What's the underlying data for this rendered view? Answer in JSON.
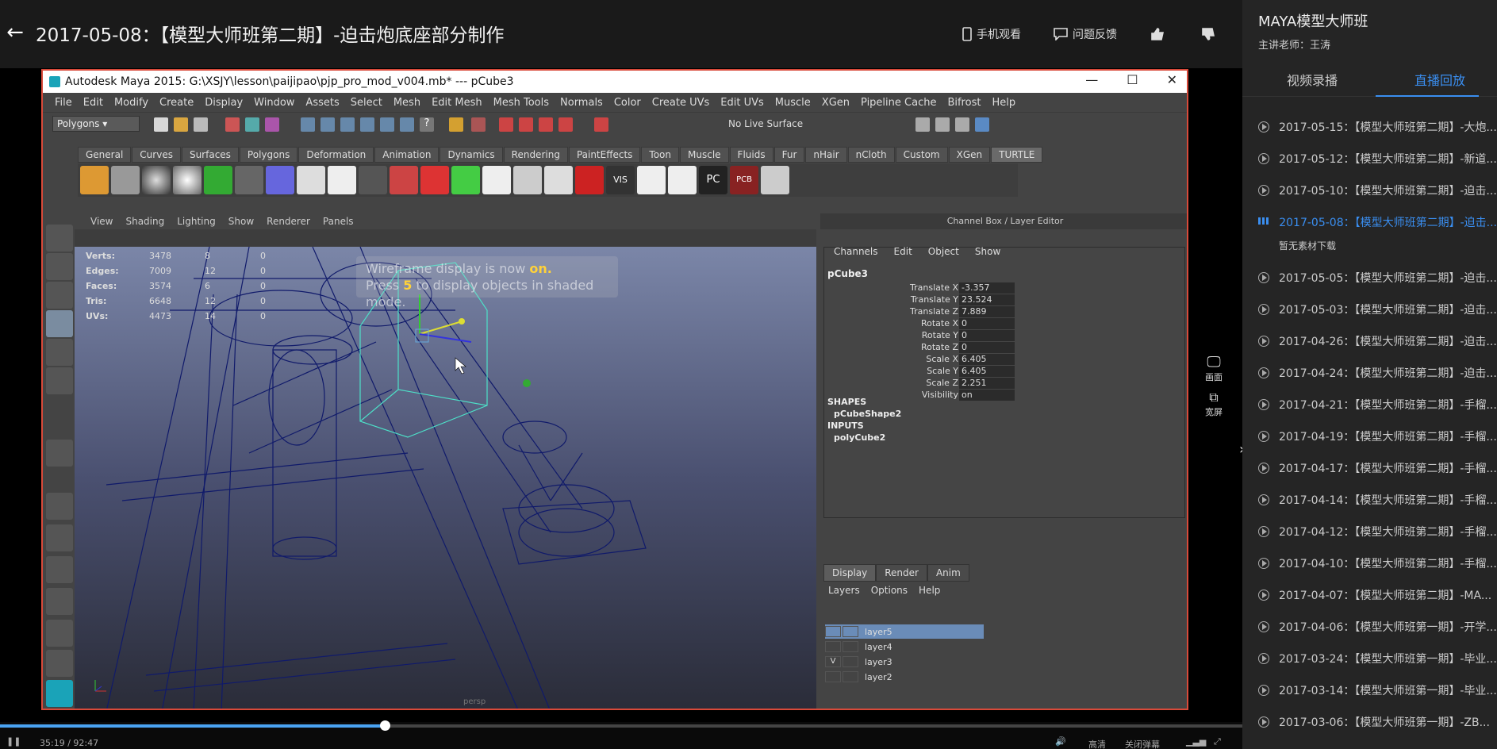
{
  "header": {
    "title": "2017-05-08：【模型大师班第二期】-迫击炮底座部分制作",
    "mobile_watch": "手机观看",
    "feedback": "问题反馈"
  },
  "maya": {
    "window_title": "Autodesk Maya 2015: G:\\XSJY\\lesson\\paijipao\\pjp_pro_mod_v004.mb*   ---   pCube3",
    "menus": [
      "File",
      "Edit",
      "Modify",
      "Create",
      "Display",
      "Window",
      "Assets",
      "Select",
      "Mesh",
      "Edit Mesh",
      "Mesh Tools",
      "Normals",
      "Color",
      "Create UVs",
      "Edit UVs",
      "Muscle",
      "XGen",
      "Pipeline Cache",
      "Bifrost",
      "Help"
    ],
    "mode": "Polygons",
    "no_live_surface": "No Live Surface",
    "shelf_tabs": [
      "General",
      "Curves",
      "Surfaces",
      "Polygons",
      "Deformation",
      "Animation",
      "Dynamics",
      "Rendering",
      "PaintEffects",
      "Toon",
      "Muscle",
      "Fluids",
      "Fur",
      "nHair",
      "nCloth",
      "Custom",
      "XGen",
      "TURTLE"
    ],
    "active_shelf_tab": "TURTLE",
    "viewport_menu": [
      "View",
      "Shading",
      "Lighting",
      "Show",
      "Renderer",
      "Panels"
    ],
    "hud": [
      {
        "label": "Verts:",
        "v1": "3478",
        "v2": "8",
        "v3": "0"
      },
      {
        "label": "Edges:",
        "v1": "7009",
        "v2": "12",
        "v3": "0"
      },
      {
        "label": "Faces:",
        "v1": "3574",
        "v2": "6",
        "v3": "0"
      },
      {
        "label": "Tris:",
        "v1": "6648",
        "v2": "12",
        "v3": "0"
      },
      {
        "label": "UVs:",
        "v1": "4473",
        "v2": "14",
        "v3": "0"
      }
    ],
    "wire_msg_1": "Wireframe display is now",
    "wire_msg_on": "on.",
    "wire_msg_2a": "Press",
    "wire_msg_key": "5",
    "wire_msg_2b": "to display objects in shaded mode.",
    "camera": "persp",
    "channel_box": {
      "title": "Channel Box / Layer Editor",
      "menu": [
        "Channels",
        "Edit",
        "Object",
        "Show"
      ],
      "object": "pCube3",
      "attrs": [
        {
          "k": "Translate X",
          "v": "-3.357"
        },
        {
          "k": "Translate Y",
          "v": "23.524"
        },
        {
          "k": "Translate Z",
          "v": "7.889"
        },
        {
          "k": "Rotate X",
          "v": "0"
        },
        {
          "k": "Rotate Y",
          "v": "0"
        },
        {
          "k": "Rotate Z",
          "v": "0"
        },
        {
          "k": "Scale X",
          "v": "6.405"
        },
        {
          "k": "Scale Y",
          "v": "6.405"
        },
        {
          "k": "Scale Z",
          "v": "2.251"
        },
        {
          "k": "Visibility",
          "v": "on"
        }
      ],
      "shapes_label": "SHAPES",
      "shape": "pCubeShape2",
      "inputs_label": "INPUTS",
      "input": "polyCube2"
    },
    "layer_tabs": [
      "Display",
      "Render",
      "Anim"
    ],
    "layer_menu": [
      "Layers",
      "Options",
      "Help"
    ],
    "layers": [
      {
        "name": "layer5",
        "v": "",
        "sel": true
      },
      {
        "name": "layer4",
        "v": "",
        "sel": false
      },
      {
        "name": "layer3",
        "v": "V",
        "sel": false
      },
      {
        "name": "layer2",
        "v": "",
        "sel": false
      }
    ]
  },
  "overlay": {
    "screen_label": "画面",
    "wide_label": "宽屏"
  },
  "player": {
    "progress": 0.31,
    "time": "35:19 / 92:47",
    "quality": "高清",
    "danmaku": "关闭弹幕"
  },
  "sidebar": {
    "course": "MAYA模型大师班",
    "teacher": "主讲老师：王涛",
    "tab_video": "视频录播",
    "tab_live": "直播回放",
    "no_material": "暂无素材下载",
    "lessons": [
      "2017-05-15：【模型大师班第二期】-大炮...",
      "2017-05-12：【模型大师班第二期】-新道...",
      "2017-05-10：【模型大师班第二期】-迫击...",
      "2017-05-08：【模型大师班第二期】-迫击...",
      "2017-05-05：【模型大师班第二期】-迫击...",
      "2017-05-03：【模型大师班第二期】-迫击...",
      "2017-04-26：【模型大师班第二期】-迫击...",
      "2017-04-24：【模型大师班第二期】-迫击...",
      "2017-04-21：【模型大师班第二期】-手榴...",
      "2017-04-19：【模型大师班第二期】-手榴...",
      "2017-04-17：【模型大师班第二期】-手榴...",
      "2017-04-14：【模型大师班第二期】-手榴...",
      "2017-04-12：【模型大师班第二期】-手榴...",
      "2017-04-10：【模型大师班第二期】-手榴...",
      "2017-04-07：【模型大师班第二期】-MA...",
      "2017-04-06：【模型大师班第一期】-开学...",
      "2017-03-24：【模型大师班第一期】-毕业...",
      "2017-03-14：【模型大师班第一期】-毕业...",
      "2017-03-06：【模型大师班第一期】-ZB..."
    ],
    "active_index": 3
  }
}
